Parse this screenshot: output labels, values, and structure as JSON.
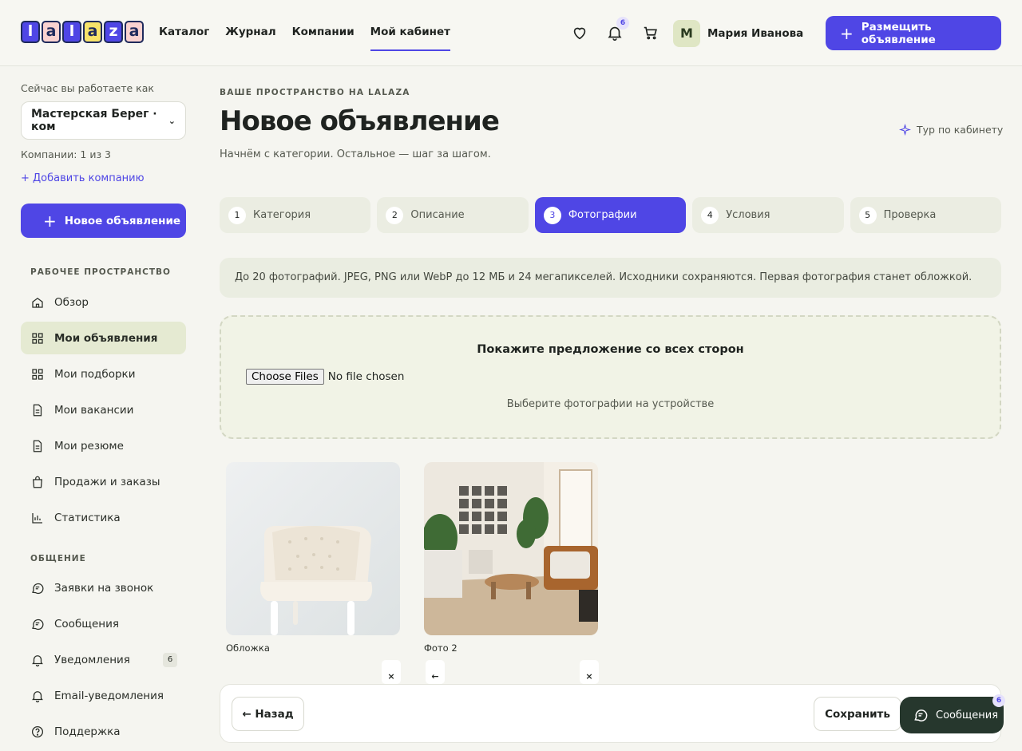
{
  "logo": {
    "letters": [
      "l",
      "a",
      "l",
      "a",
      "z",
      "a"
    ]
  },
  "nav": {
    "items": [
      {
        "label": "Каталог"
      },
      {
        "label": "Журнал"
      },
      {
        "label": "Компании"
      },
      {
        "label": "Мой кабинет",
        "active": true
      }
    ]
  },
  "header": {
    "notif_count": "6",
    "avatar_letter": "М",
    "user_name": "Мария Иванова",
    "post_button": "Размещить объявление"
  },
  "sidebar": {
    "working_as": "Сейчас вы работаете как",
    "company_selected": "Мастерская Берег · ком",
    "company_count": "Компании: 1 из 3",
    "add_company": "+ Добавить компанию",
    "new_ad": "Новое объявление",
    "section_workspace": "РАБОЧЕЕ ПРОСТРАНСТВО",
    "workspace_items": [
      {
        "label": "Обзор",
        "icon": "home-icon"
      },
      {
        "label": "Мои объявления",
        "icon": "grid-icon",
        "active": true
      },
      {
        "label": "Мои подборки",
        "icon": "grid-icon"
      },
      {
        "label": "Мои вакансии",
        "icon": "document-icon"
      },
      {
        "label": "Мои резюме",
        "icon": "document-icon"
      },
      {
        "label": "Продажи и заказы",
        "icon": "bag-icon"
      },
      {
        "label": "Статистика",
        "icon": "chart-icon"
      }
    ],
    "section_comm": "ОБЩЕНИЕ",
    "comm_items": [
      {
        "label": "Заявки на звонок",
        "icon": "chat-icon"
      },
      {
        "label": "Сообщения",
        "icon": "chat-icon"
      },
      {
        "label": "Уведомления",
        "icon": "bell-icon",
        "count": "6"
      },
      {
        "label": "Email-уведомления",
        "icon": "bell-icon"
      },
      {
        "label": "Поддержка",
        "icon": "help-icon"
      }
    ]
  },
  "main": {
    "eyebrow": "ВАШЕ ПРОСТРАНСТВО НА LALAZA",
    "title": "Новое объявление",
    "subtitle": "Начнём с категории. Остальное — шаг за шагом.",
    "tour": "Тур по кабинету",
    "steps": [
      {
        "num": "1",
        "label": "Категория"
      },
      {
        "num": "2",
        "label": "Описание"
      },
      {
        "num": "3",
        "label": "Фотографии",
        "active": true
      },
      {
        "num": "4",
        "label": "Условия"
      },
      {
        "num": "5",
        "label": "Проверка"
      }
    ],
    "info": "До 20 фотографий. JPEG, PNG или WebP до 12 МБ и 24 мегапикселей. Исходники сохраняются. Первая фотография станет обложкой.",
    "dropzone": {
      "title": "Покажите предложение со всех сторон",
      "choose_files": "Choose Files",
      "no_file": "No file chosen",
      "hint": "Выберите фотографии на устройстве"
    },
    "photos": [
      {
        "label": "Обложка",
        "remove": "×"
      },
      {
        "label": "Фото 2",
        "move_left": "←",
        "remove": "×"
      }
    ],
    "back": "← Назад",
    "save": "Сохранить"
  },
  "chat": {
    "label": "Сообщения",
    "count": "6"
  },
  "colors": {
    "accent": "#4f46e5",
    "sidebar_active": "#e5ead2",
    "chat_bg": "#26372d"
  }
}
